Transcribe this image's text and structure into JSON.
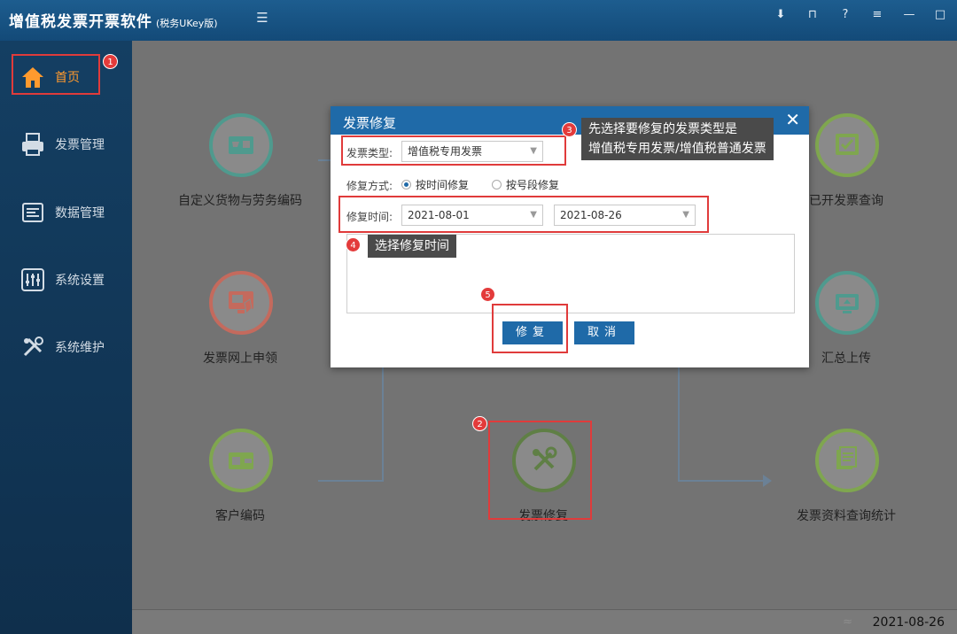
{
  "app": {
    "title": "增值税发票开票软件",
    "subtitle": "(税务UKey版)",
    "menu_icon": "menu-icon",
    "window_controls": [
      "download-icon",
      "pin-icon",
      "help-icon",
      "menu-icon",
      "minimize-icon",
      "maximize-icon"
    ]
  },
  "sidebar": {
    "items": [
      {
        "label": "首页",
        "icon": "home-icon"
      },
      {
        "label": "发票管理",
        "icon": "printer-icon"
      },
      {
        "label": "数据管理",
        "icon": "data-icon"
      },
      {
        "label": "系统设置",
        "icon": "sliders-icon"
      },
      {
        "label": "系统维护",
        "icon": "tools-icon"
      }
    ]
  },
  "tiles": [
    {
      "label": "自定义货物与劳务编码",
      "icon": "cart-card-icon",
      "color": "#4f9a8e"
    },
    {
      "label": "发票网上申领",
      "icon": "monitor-hand-icon",
      "color": "#c46a5d"
    },
    {
      "label": "客户编码",
      "icon": "wallet-icon",
      "color": "#7fa64f"
    },
    {
      "label": "发票修复",
      "icon": "tools-icon",
      "color": "#5f7f45"
    },
    {
      "label": "已开发票查询",
      "icon": "film-check-icon",
      "color": "#7fa64f"
    },
    {
      "label": "汇总上传",
      "icon": "upload-monitor-icon",
      "color": "#4f9a8e"
    },
    {
      "label": "发票资料查询统计",
      "icon": "docs-search-icon",
      "color": "#7fa64f"
    }
  ],
  "status": {
    "date": "2021-08-26",
    "wifi_icon": "wifi-icon"
  },
  "dialog": {
    "title": "发票修复",
    "close": "✕",
    "invoice_type_label": "发票类型:",
    "invoice_type_value": "增值税专用发票",
    "mode_label": "修复方式:",
    "mode_options": [
      {
        "label": "按时间修复",
        "checked": true
      },
      {
        "label": "按号段修复",
        "checked": false
      }
    ],
    "time_label": "修复时间:",
    "start_date": "2021-08-01",
    "end_date": "2021-08-26",
    "repair_button": "修复",
    "cancel_button": "取消"
  },
  "annotations": {
    "badges": [
      "1",
      "2",
      "3",
      "4",
      "5"
    ],
    "tip_3_line1": "先选择要修复的发票类型是",
    "tip_3_line2": "增值税专用发票/增值税普通发票",
    "tip_4": "选择修复时间"
  }
}
